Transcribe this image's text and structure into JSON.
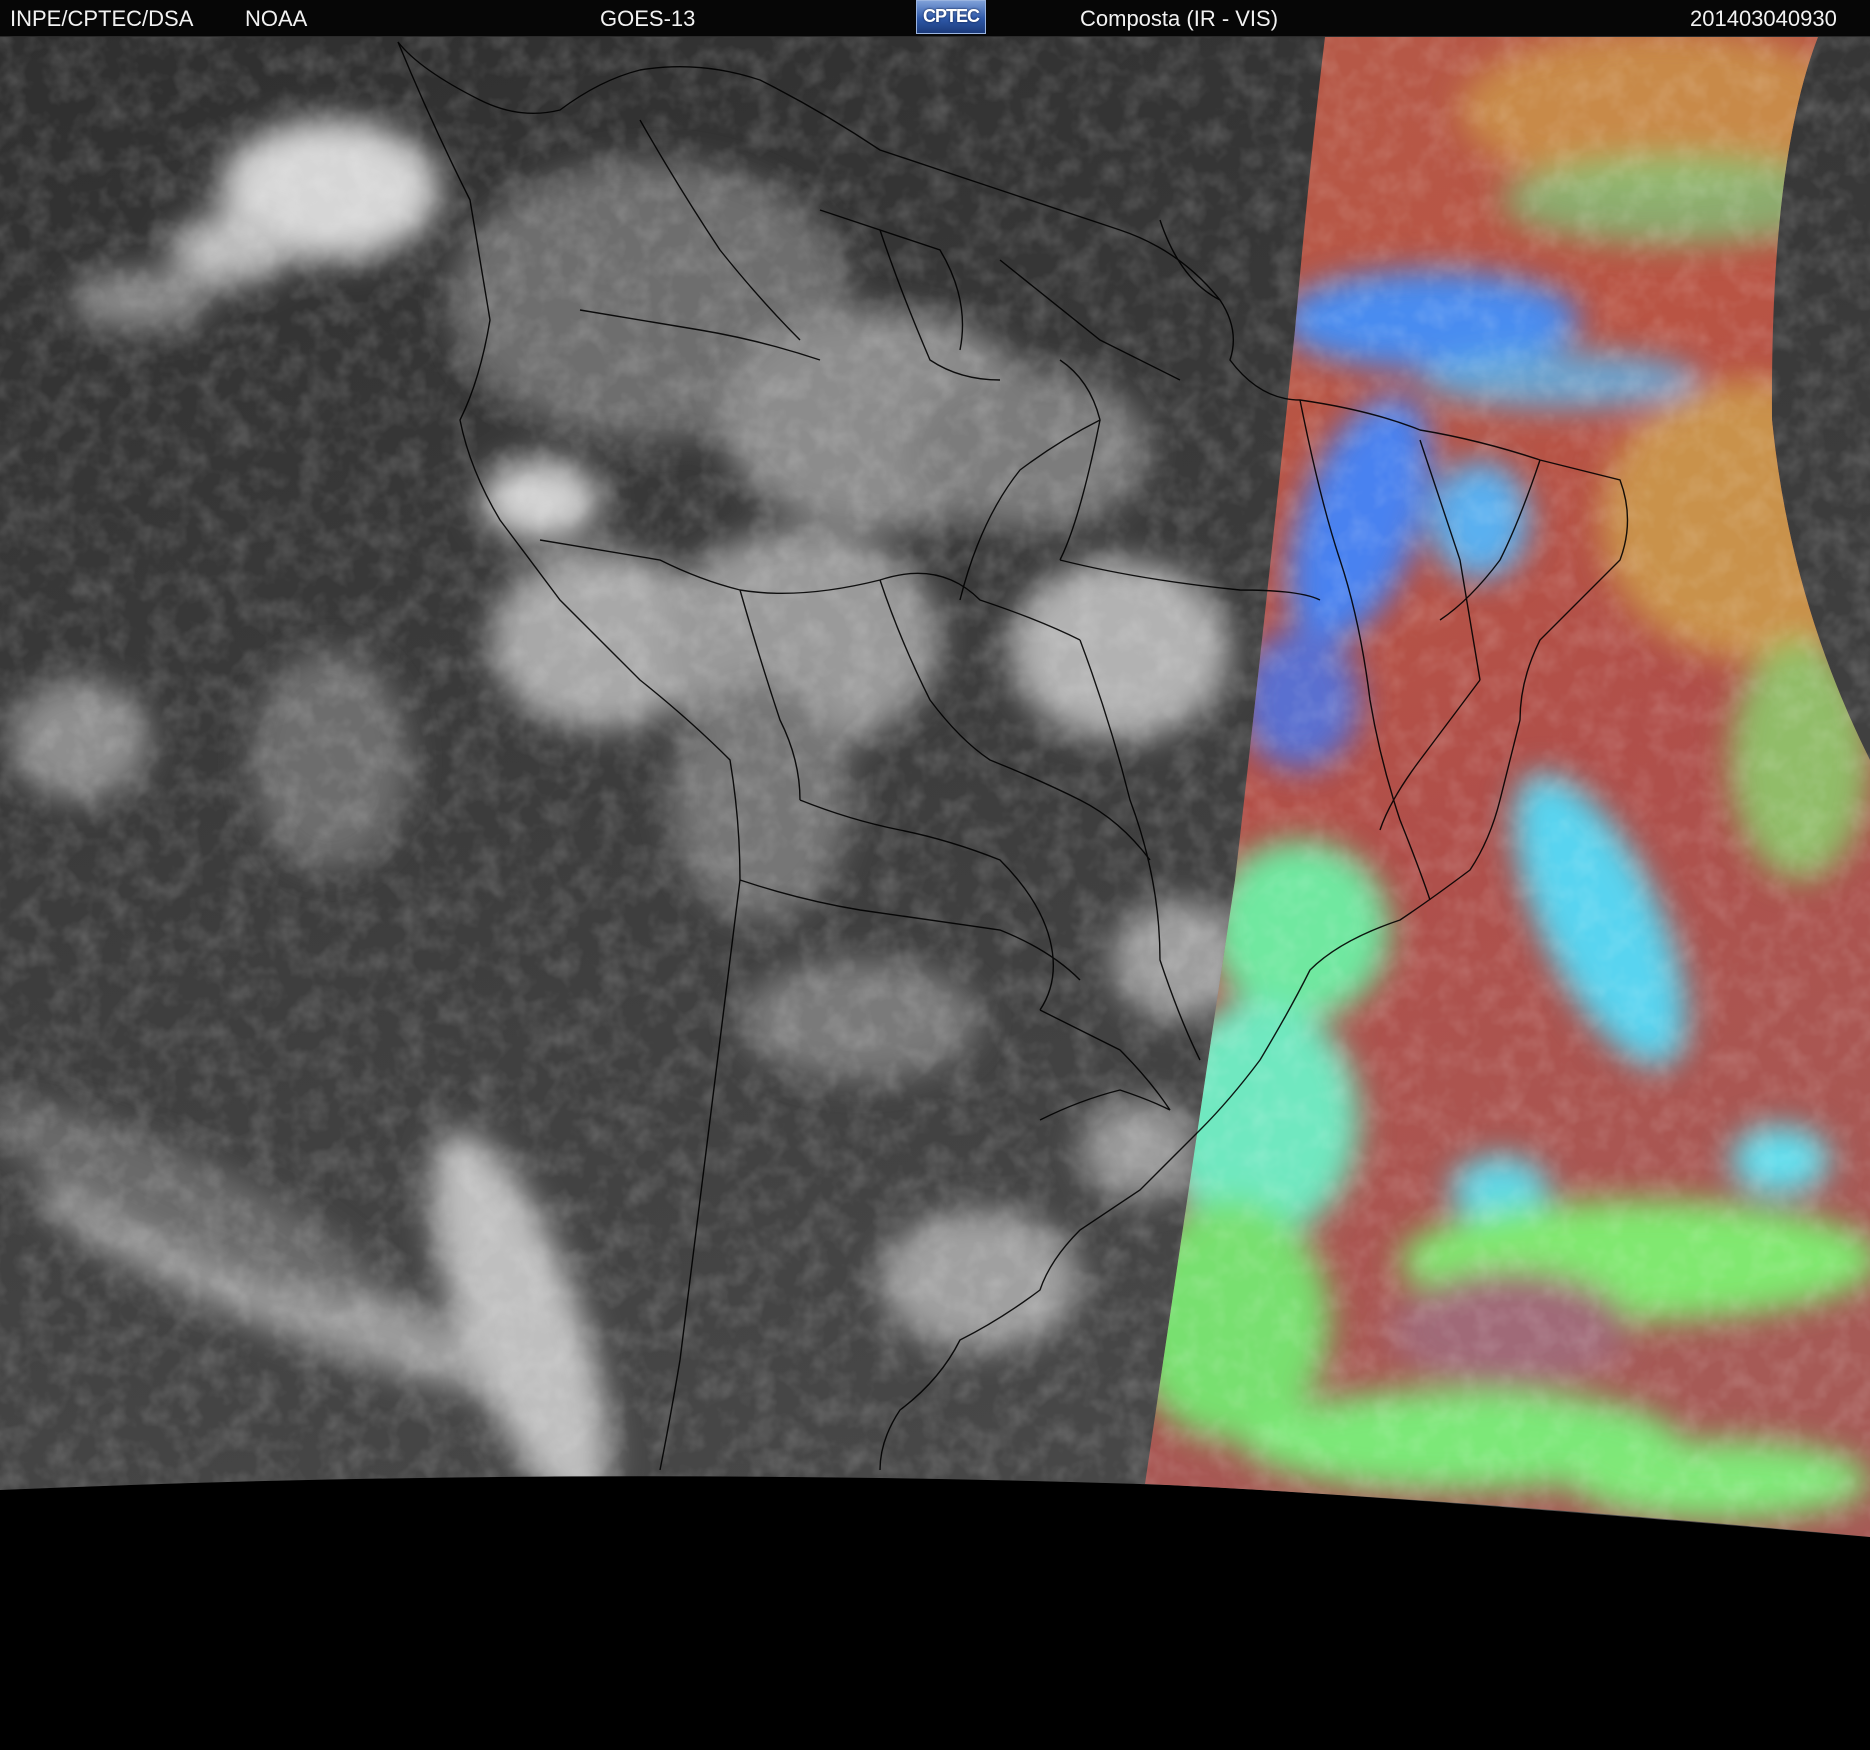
{
  "header": {
    "institution": "INPE/CPTEC/DSA",
    "agency": "NOAA",
    "satellite": "GOES-13",
    "logo_text": "CPTEC",
    "product": "Composta (IR - VIS)",
    "timestamp": "201403040930"
  },
  "colors": {
    "background": "#000000",
    "ir_gray": "#3a3a3a",
    "composite_red": "#b0524a",
    "composite_orange": "#c98a48",
    "composite_green": "#7ce878",
    "composite_cyan": "#58d8f0",
    "composite_blue": "#4478f0",
    "borders": "#000000"
  }
}
